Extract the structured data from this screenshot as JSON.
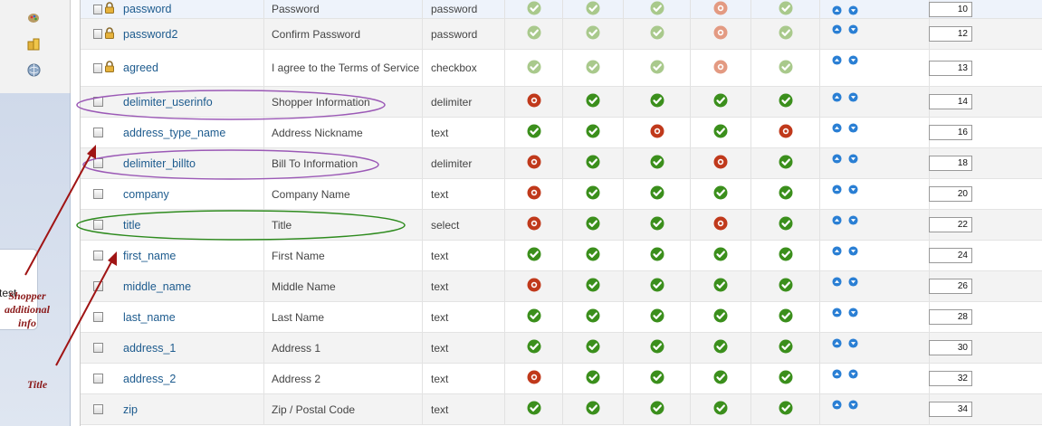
{
  "sidebar": {
    "icons": [
      "palette-icon",
      "coins-icon",
      "globe-icon"
    ],
    "panel_text": "test"
  },
  "annotations": {
    "shopper_note": "Shopper additional info",
    "title_note": "Title"
  },
  "colors": {
    "ok": "#3b8f1c",
    "no": "#c0391b",
    "ok_faded": "#a9c98c",
    "no_faded": "#e39a82",
    "purple": "#9b59b6",
    "green": "#2e8b1e",
    "arrow": "#a01414"
  },
  "rows": [
    {
      "name": "password",
      "title": "Password",
      "type": "password",
      "locked": true,
      "status": [
        "ok",
        "ok",
        "ok",
        "no",
        "ok"
      ],
      "faded": true,
      "order": "10"
    },
    {
      "name": "password2",
      "title": "Confirm Password",
      "type": "password",
      "locked": true,
      "status": [
        "ok",
        "ok",
        "ok",
        "no",
        "ok"
      ],
      "faded": true,
      "order": "12"
    },
    {
      "name": "agreed",
      "title": "I agree to the Terms of Service",
      "type": "checkbox",
      "locked": true,
      "status": [
        "ok",
        "ok",
        "ok",
        "no",
        "ok"
      ],
      "faded": true,
      "order": "13"
    },
    {
      "name": "delimiter_userinfo",
      "title": "Shopper Information",
      "type": "delimiter",
      "locked": false,
      "status": [
        "no",
        "ok",
        "ok",
        "ok",
        "ok"
      ],
      "faded": false,
      "order": "14"
    },
    {
      "name": "address_type_name",
      "title": "Address Nickname",
      "type": "text",
      "locked": false,
      "status": [
        "ok",
        "ok",
        "no",
        "ok",
        "no"
      ],
      "faded": false,
      "order": "16"
    },
    {
      "name": "delimiter_billto",
      "title": "Bill To Information",
      "type": "delimiter",
      "locked": false,
      "status": [
        "no",
        "ok",
        "ok",
        "no",
        "ok"
      ],
      "faded": false,
      "order": "18"
    },
    {
      "name": "company",
      "title": "Company Name",
      "type": "text",
      "locked": false,
      "status": [
        "no",
        "ok",
        "ok",
        "ok",
        "ok"
      ],
      "faded": false,
      "order": "20"
    },
    {
      "name": "title",
      "title": "Title",
      "type": "select",
      "locked": false,
      "status": [
        "no",
        "ok",
        "ok",
        "no",
        "ok"
      ],
      "faded": false,
      "order": "22"
    },
    {
      "name": "first_name",
      "title": "First Name",
      "type": "text",
      "locked": false,
      "status": [
        "ok",
        "ok",
        "ok",
        "ok",
        "ok"
      ],
      "faded": false,
      "order": "24"
    },
    {
      "name": "middle_name",
      "title": "Middle Name",
      "type": "text",
      "locked": false,
      "status": [
        "no",
        "ok",
        "ok",
        "ok",
        "ok"
      ],
      "faded": false,
      "order": "26"
    },
    {
      "name": "last_name",
      "title": "Last Name",
      "type": "text",
      "locked": false,
      "status": [
        "ok",
        "ok",
        "ok",
        "ok",
        "ok"
      ],
      "faded": false,
      "order": "28"
    },
    {
      "name": "address_1",
      "title": "Address 1",
      "type": "text",
      "locked": false,
      "status": [
        "ok",
        "ok",
        "ok",
        "ok",
        "ok"
      ],
      "faded": false,
      "order": "30"
    },
    {
      "name": "address_2",
      "title": "Address 2",
      "type": "text",
      "locked": false,
      "status": [
        "no",
        "ok",
        "ok",
        "ok",
        "ok"
      ],
      "faded": false,
      "order": "32"
    },
    {
      "name": "zip",
      "title": "Zip / Postal Code",
      "type": "text",
      "locked": false,
      "status": [
        "ok",
        "ok",
        "ok",
        "ok",
        "ok"
      ],
      "faded": false,
      "order": "34"
    }
  ]
}
